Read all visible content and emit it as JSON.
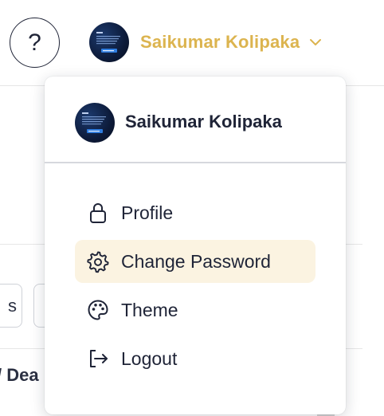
{
  "header": {
    "help_label": "?",
    "user_name": "Saikumar Kolipaka",
    "accent_color": "#dcb44f"
  },
  "dropdown": {
    "user_name": "Saikumar Kolipaka",
    "items": [
      {
        "label": "Profile",
        "icon": "lock-icon",
        "active": false
      },
      {
        "label": "Change Password",
        "icon": "gear-icon",
        "active": true
      },
      {
        "label": "Theme",
        "icon": "palette-icon",
        "active": false
      },
      {
        "label": "Logout",
        "icon": "logout-icon",
        "active": false
      }
    ]
  },
  "background": {
    "chip_text": "s",
    "partial_heading": "/ Dea"
  },
  "colors": {
    "text": "#1f2437",
    "active_item_bg": "#fbf3e1",
    "divider": "#d6d8dd"
  }
}
